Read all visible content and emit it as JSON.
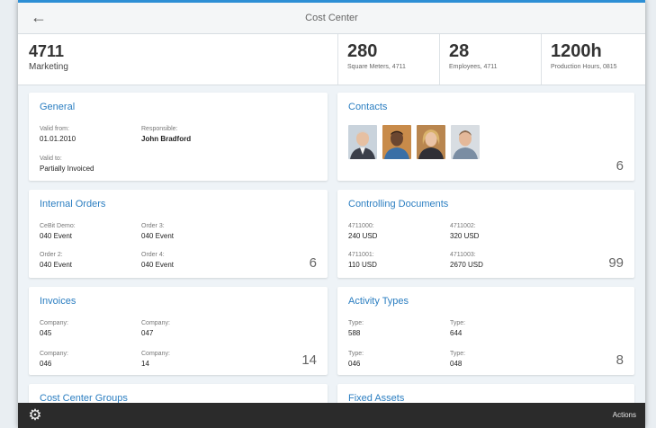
{
  "nav": {
    "title": "Cost Center"
  },
  "header": {
    "id": "4711",
    "description": "Marketing",
    "kpis": [
      {
        "value": "280",
        "label": "Square Meters, 4711"
      },
      {
        "value": "28",
        "label": "Employees, 4711"
      },
      {
        "value": "1200h",
        "label": "Production Hours, 0815"
      }
    ]
  },
  "general": {
    "title": "General",
    "valid_from_label": "Valid from:",
    "valid_from": "01.01.2010",
    "responsible_label": "Responsible:",
    "responsible": "John Bradford",
    "valid_to_label": "Valid to:",
    "valid_to": "Partially Invoiced"
  },
  "contacts": {
    "title": "Contacts",
    "count": "6"
  },
  "internal_orders": {
    "title": "Internal Orders",
    "count": "6",
    "items": [
      {
        "label": "CeBit Demo:",
        "value": "040 Event"
      },
      {
        "label": "Order 3:",
        "value": "040 Event"
      },
      {
        "label": "Order 2:",
        "value": "040 Event"
      },
      {
        "label": "Order 4:",
        "value": "040 Event"
      }
    ]
  },
  "controlling_documents": {
    "title": "Controlling Documents",
    "count": "99",
    "items": [
      {
        "label": "4711000:",
        "value": "240 USD"
      },
      {
        "label": "4711002:",
        "value": "320 USD"
      },
      {
        "label": "4711001:",
        "value": "110 USD"
      },
      {
        "label": "4711003:",
        "value": "2670 USD"
      }
    ]
  },
  "invoices": {
    "title": "Invoices",
    "count": "14",
    "items": [
      {
        "label": "Company:",
        "value": "045"
      },
      {
        "label": "Company:",
        "value": "047"
      },
      {
        "label": "Company:",
        "value": "046"
      },
      {
        "label": "Company:",
        "value": "14"
      }
    ]
  },
  "activity_types": {
    "title": "Activity Types",
    "count": "8",
    "items": [
      {
        "label": "Type:",
        "value": "588"
      },
      {
        "label": "Type:",
        "value": "644"
      },
      {
        "label": "Type:",
        "value": "046"
      },
      {
        "label": "Type:",
        "value": "048"
      }
    ]
  },
  "cost_center_groups": {
    "title": "Cost Center Groups"
  },
  "fixed_assets": {
    "title": "Fixed Assets"
  },
  "footer": {
    "actions_label": "Actions"
  },
  "icons": {
    "back": "arrow-left-icon",
    "settings": "gear-icon"
  },
  "colors": {
    "accent": "#2b7ec1",
    "footer": "#2b2b2b",
    "topline": "#2d8fd5"
  }
}
